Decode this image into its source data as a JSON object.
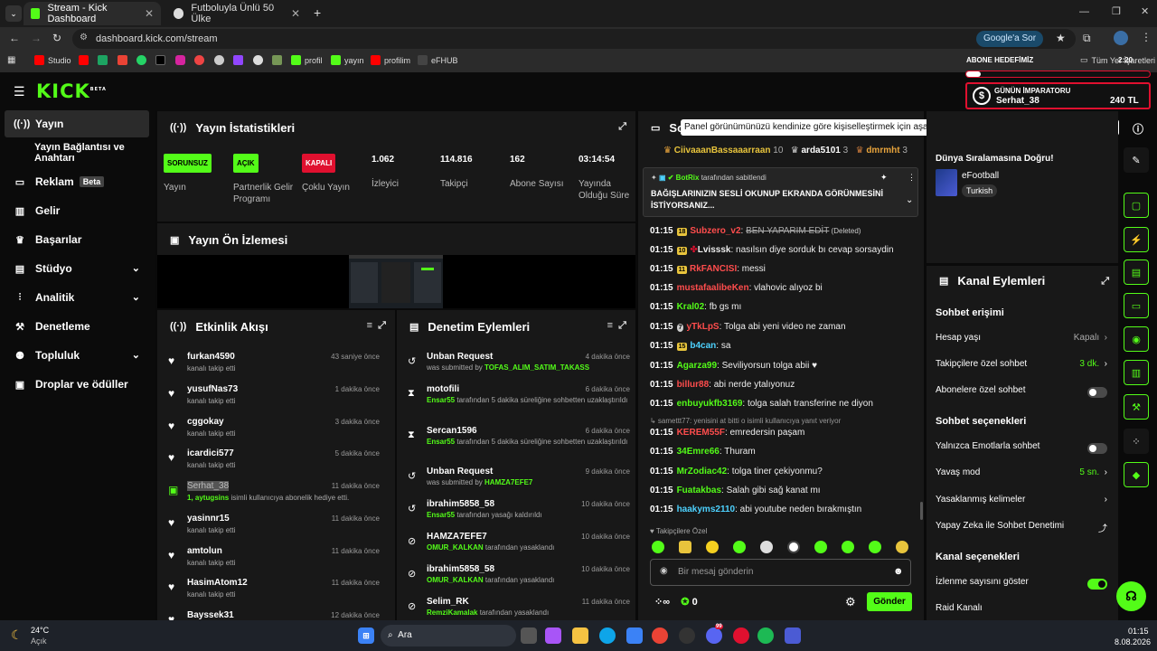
{
  "browser": {
    "tab1": "Stream - Kick Dashboard",
    "tab2": "Futboluyla Ünlü 50 Ülke",
    "url": "dashboard.kick.com/stream",
    "google_btn": "Google'a Sor",
    "bookmarks": [
      "Studio",
      "profil",
      "yayın",
      "profilim",
      "eFHUB"
    ],
    "bookmarks_all": "Tüm Yer İşaretleri"
  },
  "header": {
    "logo": "KICK",
    "logo_sup": "BETA"
  },
  "overlay": {
    "abone_label": "ABONE HEDEFİMİZ",
    "time": "2:20",
    "gun_label": "GÜNÜN İMPARATORU",
    "gun_user": "Serhat_38",
    "gun_amount": "240 TL"
  },
  "sidebar": {
    "items": [
      {
        "label": "Yayın",
        "icon": "broadcast-icon"
      },
      {
        "label": "Yayın Bağlantısı ve Anahtarı"
      },
      {
        "label": "Reklam",
        "badge": "Beta",
        "icon": "tv-icon"
      },
      {
        "label": "Gelir",
        "icon": "chart-icon"
      },
      {
        "label": "Başarılar",
        "icon": "trophy-icon"
      },
      {
        "label": "Stüdyo",
        "icon": "studio-icon"
      },
      {
        "label": "Analitik",
        "icon": "analytics-icon"
      },
      {
        "label": "Denetleme",
        "icon": "hammer-icon"
      },
      {
        "label": "Topluluk",
        "icon": "community-icon"
      },
      {
        "label": "Droplar ve ödüller",
        "icon": "gift-icon"
      }
    ]
  },
  "stats": {
    "title": "Yayın İstatistikleri",
    "items": [
      {
        "badge": "SORUNSUZ",
        "label": "Yayın",
        "color": "#53fc18"
      },
      {
        "badge": "AÇIK",
        "label": "Partnerlik Gelir Programı",
        "color": "#53fc18"
      },
      {
        "badge": "KAPALI",
        "label": "Çoklu Yayın",
        "color": "#e0102f"
      },
      {
        "value": "1.062",
        "label": "İzleyici"
      },
      {
        "value": "114.816",
        "label": "Takipçi"
      },
      {
        "value": "162",
        "label": "Abone Sayısı"
      },
      {
        "value": "03:14:54",
        "label": "Yayında Olduğu Süre"
      }
    ]
  },
  "preview": {
    "title": "Yayın Ön İzlemesi"
  },
  "activity": {
    "title": "Etkinlik Akışı",
    "items": [
      {
        "name": "furkan4590",
        "sub": "kanalı takip etti",
        "time": "43 saniye önce"
      },
      {
        "name": "yusufNas73",
        "sub": "kanalı takip etti",
        "time": "1 dakika önce"
      },
      {
        "name": "cggokay",
        "sub": "kanalı takip etti",
        "time": "3 dakika önce"
      },
      {
        "name": "icardici577",
        "sub": "kanalı takip etti",
        "time": "5 dakika önce"
      },
      {
        "name": "Serhat_38",
        "sub_bold": "1, aytugsins",
        "sub": " isimli kullanıcıya abonelik hediye etti.",
        "time": "11 dakika önce",
        "gift": true
      },
      {
        "name": "yasinnr15",
        "sub": "kanalı takip etti",
        "time": "11 dakika önce"
      },
      {
        "name": "amtolun",
        "sub": "kanalı takip etti",
        "time": "11 dakika önce"
      },
      {
        "name": "HasimAtom12",
        "sub": "kanalı takip etti",
        "time": "11 dakika önce"
      },
      {
        "name": "Bayssek31",
        "sub": "",
        "time": "12 dakika önce"
      }
    ]
  },
  "moderation": {
    "title": "Denetim Eylemleri",
    "items": [
      {
        "name": "Unban Request",
        "pre": "was submitted by ",
        "who": "TOFAS_ALIM_SATIM_TAKASS",
        "post": "",
        "time": "4 dakika önce",
        "icon": "undo-icon"
      },
      {
        "name": "motofili",
        "pre": "",
        "who": "Ensar55",
        "post": " tarafından 5 dakika süreliğine sohbetten uzaklaştırıldı",
        "time": "6 dakika önce",
        "icon": "timer-icon"
      },
      {
        "name": "Sercan1596",
        "pre": "",
        "who": "Ensar55",
        "post": " tarafından 5 dakika süreliğine sohbetten uzaklaştırıldı",
        "time": "6 dakika önce",
        "icon": "timer-icon"
      },
      {
        "name": "Unban Request",
        "pre": "was submitted by ",
        "who": "HAMZA7EFE7",
        "post": "",
        "time": "9 dakika önce",
        "icon": "undo-icon"
      },
      {
        "name": "ibrahim5858_58",
        "pre": "",
        "who": "Ensar55",
        "post": " tarafından yasağı kaldırıldı",
        "time": "10 dakika önce",
        "icon": "undo-icon"
      },
      {
        "name": "HAMZA7EFE7",
        "pre": "",
        "who": "OMUR_KALKAN",
        "post": " tarafından yasaklandı",
        "time": "10 dakika önce",
        "icon": "ban-icon"
      },
      {
        "name": "ibrahim5858_58",
        "pre": "",
        "who": "OMUR_KALKAN",
        "post": " tarafından yasaklandı",
        "time": "10 dakika önce",
        "icon": "ban-icon"
      },
      {
        "name": "Selim_RK",
        "pre": "",
        "who": "RemziKamalak",
        "post": " tarafından yasaklandı",
        "time": "11 dakika önce",
        "icon": "ban-icon"
      }
    ]
  },
  "chat": {
    "title": "So",
    "tooltip": "Panel görünümünüzü kendinize göre kişiselleştirmek için aşağıdaki ekran araçlarına tıklayın veya sürükleyin",
    "top": [
      {
        "name": "CiivaaanBassaaarraan",
        "count": "10"
      },
      {
        "name": "arda5101",
        "count": "3"
      },
      {
        "name": "dmrmht",
        "count": "3"
      }
    ],
    "pinned_by": "BotRix",
    "pinned_suffix": "tarafından sabitlendi",
    "pinned_text": "BAĞIŞLARINIZIN SESLİ OKUNUP EKRANDA GÖRÜNMESİNİ İSTİYORSANIZ...",
    "messages": [
      {
        "t": "01:15",
        "badge": "18",
        "user": "Subzero_v2",
        "color": "#ff4d4d",
        "text": "BEN YAPARIM EDİT",
        "extra": " (Deleted)",
        "strike": true
      },
      {
        "t": "01:15",
        "badge": "10",
        "user": "Lvisssk",
        "color": "#fff",
        "text": "nasılsın diye sorduk bı cevap sorsaydin"
      },
      {
        "t": "01:15",
        "badge": "11",
        "user": "RkFANCISI",
        "color": "#ff4d4d",
        "text": "messi"
      },
      {
        "t": "01:15",
        "user": "mustafaalibeKen",
        "color": "#ff4d4d",
        "text": "vlahovic alıyoz bi"
      },
      {
        "t": "01:15",
        "user": "Kral02",
        "color": "#53fc18",
        "text": "fb gs mı"
      },
      {
        "t": "01:15",
        "badge": "7",
        "user": "yTkLpS",
        "color": "#ff4d4d",
        "text": "Tolga abi yeni video ne zaman"
      },
      {
        "t": "01:15",
        "badge": "15",
        "user": "b4can",
        "color": "#4dd2ff",
        "text": "sa"
      },
      {
        "t": "01:15",
        "user": "Agarza99",
        "color": "#53fc18",
        "text": "Seviliyorsun tolga abii ♥"
      },
      {
        "t": "01:15",
        "user": "billur88",
        "color": "#ff4d4d",
        "text": "abi nerde ytalıyonuz"
      },
      {
        "t": "01:15",
        "user": "enbuyukfb3169",
        "color": "#53fc18",
        "text": "tolga salah transferine ne diyon"
      },
      {
        "t": "",
        "user": "",
        "color": "#aaa",
        "text": "↳ samettt77: yenisini at bitti o isimli kullanıcıya yanıt veriyor",
        "reply": true
      },
      {
        "t": "01:15",
        "user": "KEREM55F",
        "color": "#ff4d4d",
        "text": "emredersin paşam"
      },
      {
        "t": "01:15",
        "user": "34Emre66",
        "color": "#53fc18",
        "text": "Thuram"
      },
      {
        "t": "01:15",
        "user": "MrZodiac42",
        "color": "#53fc18",
        "text": "tolga tiner çekiyonmu?"
      },
      {
        "t": "01:15",
        "user": "Fuatakbas",
        "color": "#53fc18",
        "text": "Salah gibi sağ kanat mı"
      },
      {
        "t": "01:15",
        "user": "haakyms2110",
        "color": "#4dd2ff",
        "text": "abi youtube neden bırakmıştın"
      }
    ],
    "followers_only": "Takipçilere Özel",
    "input_placeholder": "Bir mesaj gönderin",
    "infinity": "∞",
    "kick_count": "0",
    "send": "Gönder"
  },
  "dunya": {
    "title": "Dünya Sıralamasına Doğru!",
    "game": "eFootball",
    "lang": "Turkish"
  },
  "channel": {
    "title": "Kanal Eylemleri",
    "sec1": "Sohbet erişimi",
    "hesap": "Hesap yaşı",
    "hesap_val": "Kapalı",
    "takipci": "Takipçilere özel sohbet",
    "takipci_val": "3 dk.",
    "abone": "Abonelere özel sohbet",
    "sec2": "Sohbet seçenekleri",
    "emote": "Yalnızca Emotlarla sohbet",
    "yavas": "Yavaş mod",
    "yavas_val": "5 sn.",
    "yasak": "Yasaklanmış kelimeler",
    "yapay": "Yapay Zeka ile Sohbet Denetimi",
    "sec3": "Kanal seçenekleri",
    "izlenme": "İzlenme sayısını göster",
    "raid": "Raid Kanalı"
  },
  "taskbar": {
    "weather_temp": "24°C",
    "weather_desc": "Açık",
    "search": "Ara",
    "time": "01:15",
    "date": "8.08.2026",
    "notif": "99"
  }
}
